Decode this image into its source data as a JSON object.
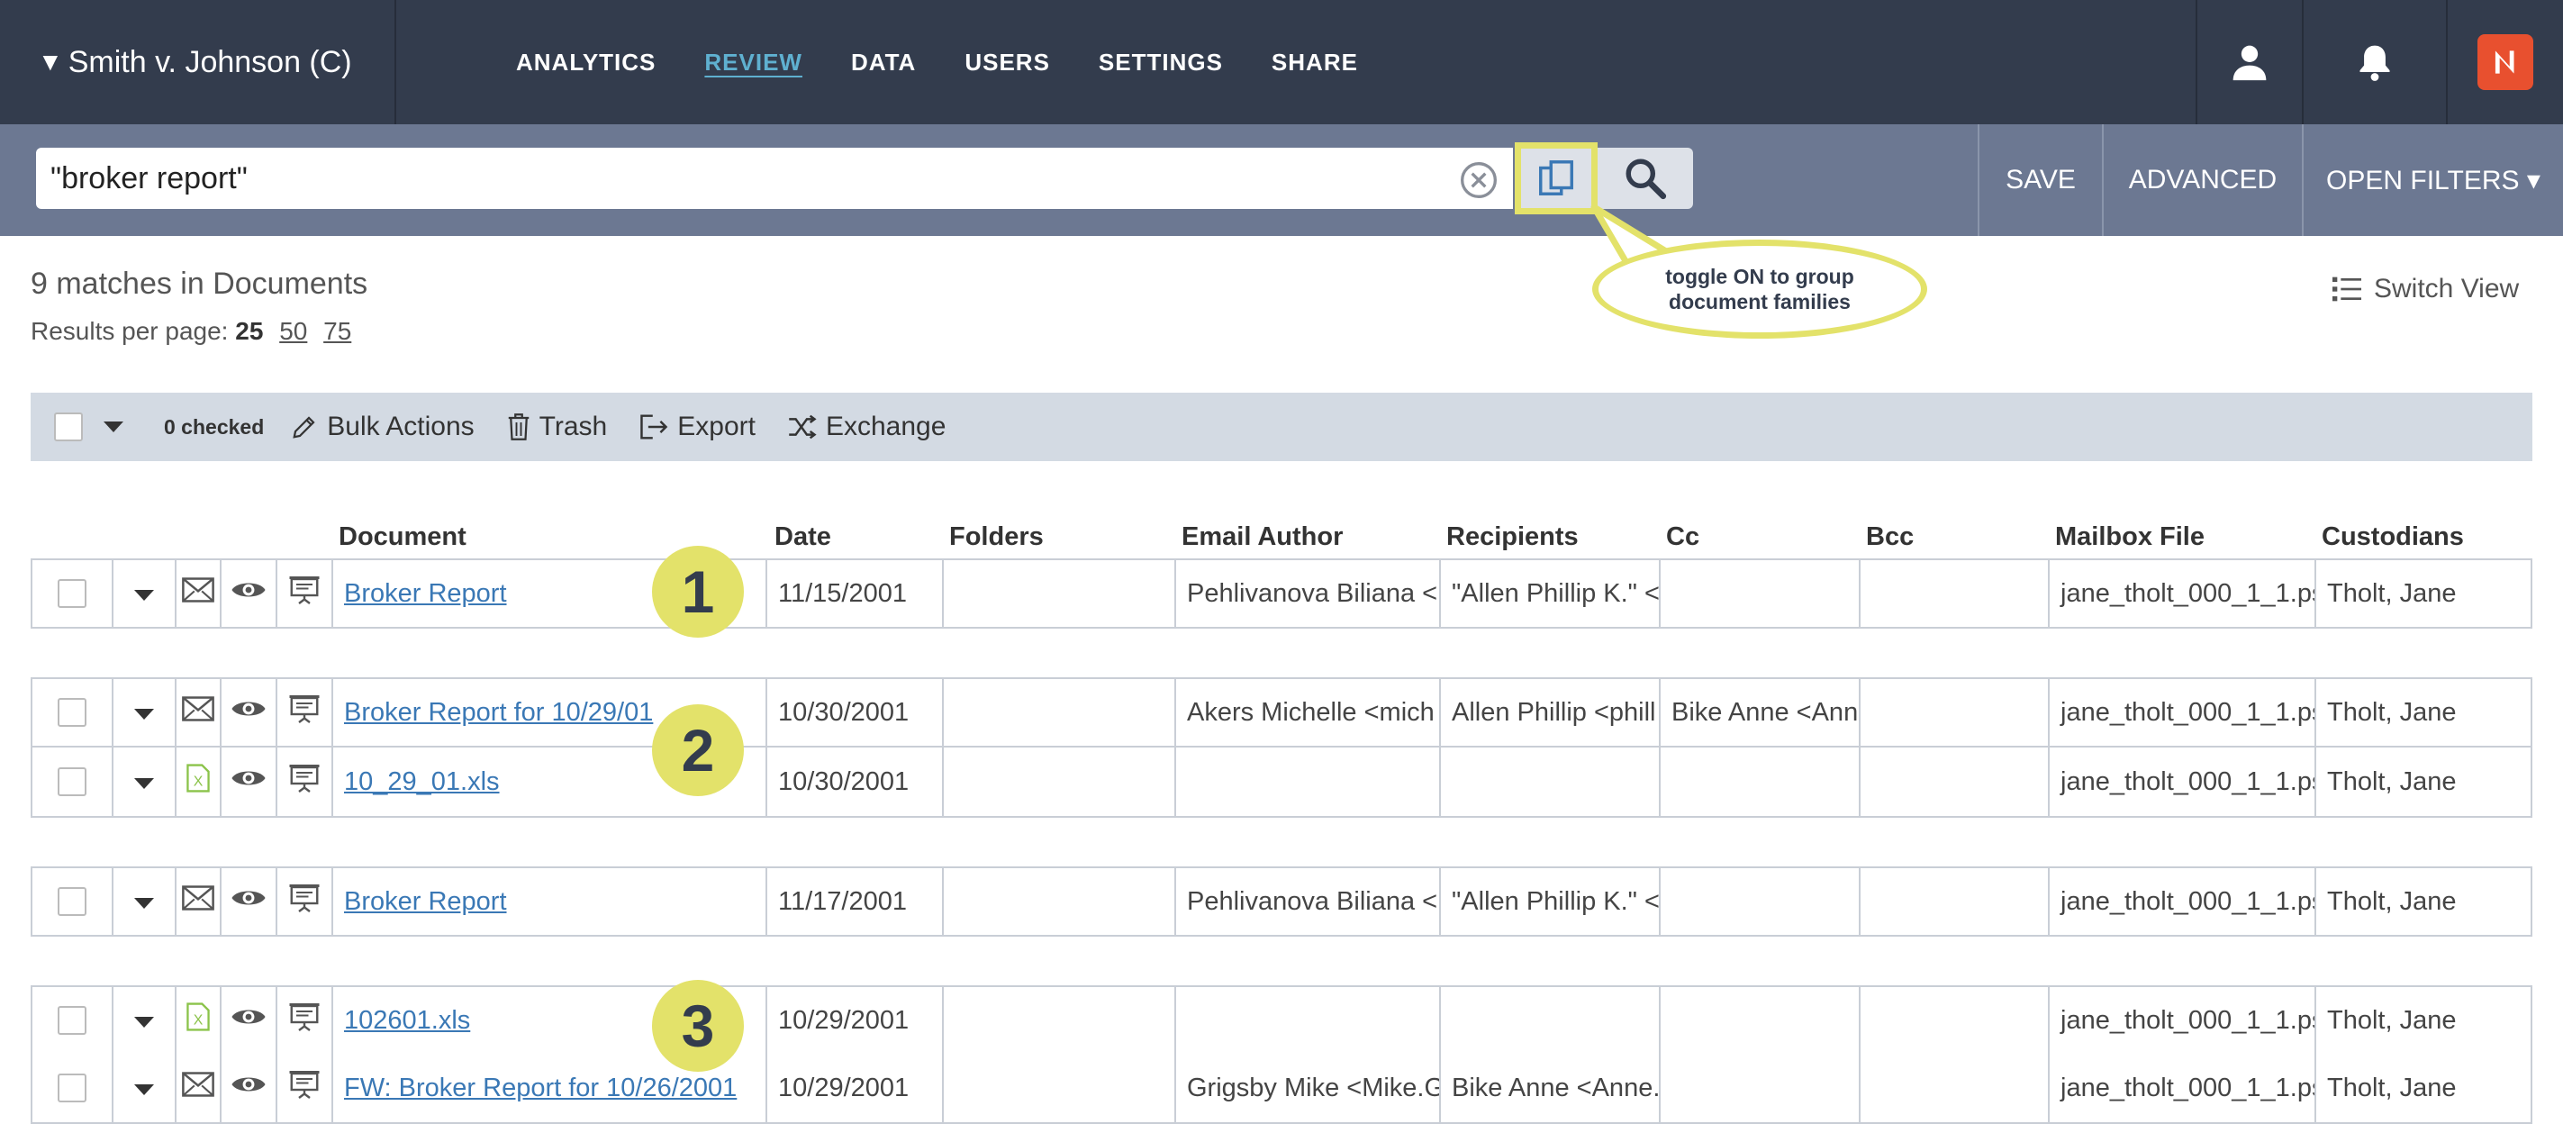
{
  "header": {
    "case_title": "Smith v. Johnson (C)",
    "nav": [
      {
        "label": "ANALYTICS",
        "active": false
      },
      {
        "label": "REVIEW",
        "active": true
      },
      {
        "label": "DATA",
        "active": false
      },
      {
        "label": "USERS",
        "active": false
      },
      {
        "label": "SETTINGS",
        "active": false
      },
      {
        "label": "SHARE",
        "active": false
      }
    ],
    "logo_color": "#e8502f",
    "bar_color": "#333c4d",
    "active_nav_color": "#5fb0d0"
  },
  "search": {
    "value": "\"broker report\"",
    "actions": {
      "save": "SAVE",
      "advanced": "ADVANCED",
      "open_filters": "OPEN FILTERS ▾"
    }
  },
  "callout": {
    "line1": "toggle ON to group",
    "line2": "document families",
    "highlight_color": "#e3e26a"
  },
  "results": {
    "matches": "9 matches in Documents",
    "per_page_label": "Results per page:",
    "per_page_selected": "25",
    "per_page_options": [
      "50",
      "75"
    ],
    "switch_view": "Switch View"
  },
  "actionbar": {
    "checked": "0 checked",
    "bulk": "Bulk Actions",
    "trash": "Trash",
    "export": "Export",
    "exchange": "Exchange"
  },
  "columns": [
    "Document",
    "Date",
    "Folders",
    "Email Author",
    "Recipients",
    "Cc",
    "Bcc",
    "Mailbox File",
    "Custodians"
  ],
  "rows": [
    {
      "type": "email",
      "document": "Broker Report",
      "date": "11/15/2001",
      "folders": "",
      "author": "Pehlivanova Biliana <",
      "recipients": "\"Allen Phillip K.\" <l",
      "cc": "",
      "bcc": "",
      "mailbox": "jane_tholt_000_1_1.ps",
      "custodians": "Tholt, Jane"
    },
    {
      "type": "email",
      "document": "Broker Report for 10/29/01",
      "date": "10/30/2001",
      "folders": "",
      "author": "Akers Michelle <mich",
      "recipients": "Allen Phillip <phill",
      "cc": "Bike Anne <Ann",
      "bcc": "",
      "mailbox": "jane_tholt_000_1_1.ps",
      "custodians": "Tholt, Jane"
    },
    {
      "type": "xls",
      "document": "10_29_01.xls",
      "date": "10/30/2001",
      "folders": "",
      "author": "",
      "recipients": "",
      "cc": "",
      "bcc": "",
      "mailbox": "jane_tholt_000_1_1.ps",
      "custodians": "Tholt, Jane"
    },
    {
      "type": "email",
      "document": "Broker Report",
      "date": "11/17/2001",
      "folders": "",
      "author": "Pehlivanova Biliana <",
      "recipients": "\"Allen Phillip K.\" <l",
      "cc": "",
      "bcc": "",
      "mailbox": "jane_tholt_000_1_1.ps",
      "custodians": "Tholt, Jane"
    },
    {
      "type": "xls",
      "document": "102601.xls",
      "date": "10/29/2001",
      "folders": "",
      "author": "",
      "recipients": "",
      "cc": "",
      "bcc": "",
      "mailbox": "jane_tholt_000_1_1.ps",
      "custodians": "Tholt, Jane"
    },
    {
      "type": "email",
      "document": "FW: Broker Report for 10/26/2001",
      "date": "10/29/2001",
      "folders": "",
      "author": "Grigsby Mike <Mike.G",
      "recipients": "Bike Anne <Anne.",
      "cc": "",
      "bcc": "",
      "mailbox": "jane_tholt_000_1_1.ps",
      "custodians": "Tholt, Jane"
    }
  ],
  "badges": [
    "1",
    "2",
    "3"
  ],
  "icons": {
    "email": "envelope-icon",
    "xls": "excel-icon",
    "view": "eye-icon",
    "present": "presentation-icon"
  }
}
